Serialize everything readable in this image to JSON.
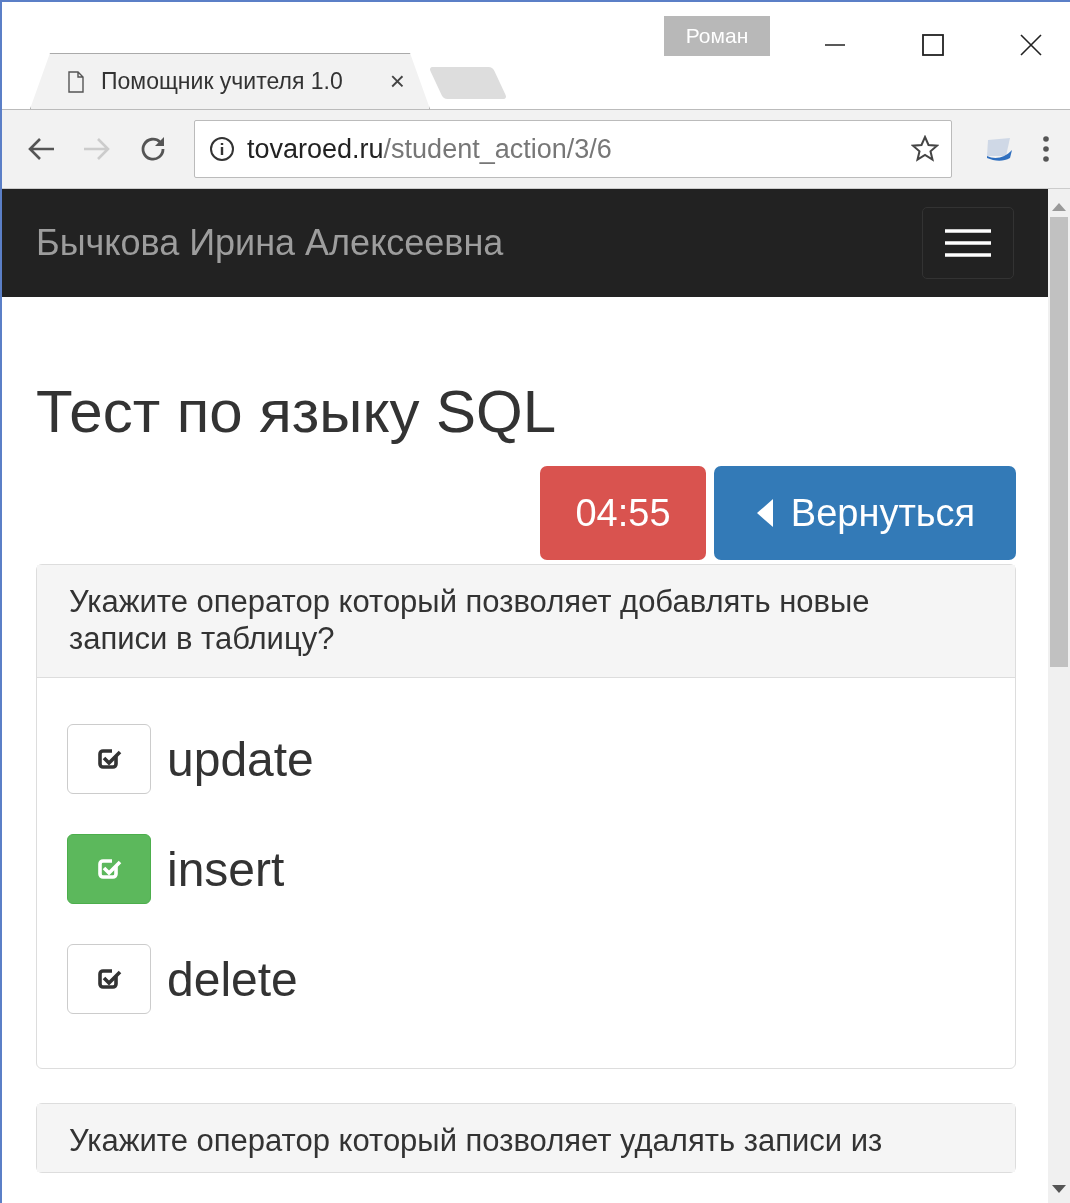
{
  "window": {
    "profile": "Роман"
  },
  "tabs": [
    {
      "title": "Помощник учителя 1.0",
      "close": "×",
      "selected": true
    }
  ],
  "address_bar": {
    "host": "tovaroed.ru",
    "path": "/student_action/3/6"
  },
  "navbar": {
    "brand": "Бычкова Ирина Алексеевна"
  },
  "page": {
    "title": "Тест по языку SQL",
    "timer": "04:55",
    "back_button": "Вернуться"
  },
  "questions": [
    {
      "text": "Укажите оператор который позволяет добавлять новые записи в таблицу?",
      "answers": [
        {
          "label": "update",
          "selected": false
        },
        {
          "label": "insert",
          "selected": true
        },
        {
          "label": "delete",
          "selected": false
        }
      ]
    },
    {
      "text": "Укажите оператор который позволяет удалять записи из"
    }
  ]
}
